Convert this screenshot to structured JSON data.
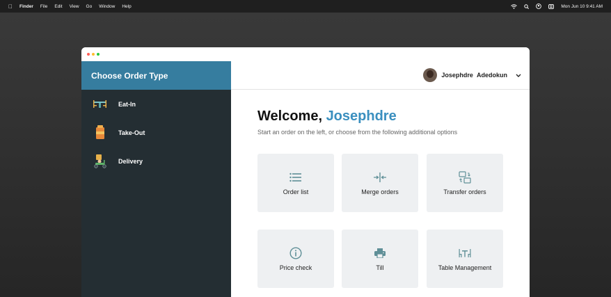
{
  "menubar": {
    "app": "Finder",
    "items": [
      "File",
      "Edit",
      "View",
      "Go",
      "Window",
      "Help"
    ],
    "clock": "Mon Jun 10  9:41 AM"
  },
  "sidebar": {
    "title": "Choose Order Type",
    "items": [
      {
        "label": "Eat-In",
        "icon": "dining-table-icon"
      },
      {
        "label": "Take-Out",
        "icon": "takeout-bag-icon"
      },
      {
        "label": "Delivery",
        "icon": "delivery-scooter-icon"
      }
    ]
  },
  "header": {
    "user_name": "Josephdre  Adedokun"
  },
  "main": {
    "welcome_prefix": "Welcome, ",
    "welcome_name": "Josephdre",
    "subtitle": "Start an order on the left, or choose from the following additional options",
    "cards": [
      {
        "label": "Order list",
        "icon": "list-icon"
      },
      {
        "label": "Merge orders",
        "icon": "merge-icon"
      },
      {
        "label": "Transfer orders",
        "icon": "transfer-icon"
      },
      {
        "label": "Price check",
        "icon": "info-icon"
      },
      {
        "label": "Till",
        "icon": "printer-icon"
      },
      {
        "label": "Table Management",
        "icon": "table-icon"
      }
    ]
  },
  "colors": {
    "sidebar_bg": "#242e33",
    "sidebar_header": "#367d9f",
    "accent": "#3a8fbf",
    "card_bg": "#eef0f2",
    "icon_color": "#5f8f97"
  }
}
